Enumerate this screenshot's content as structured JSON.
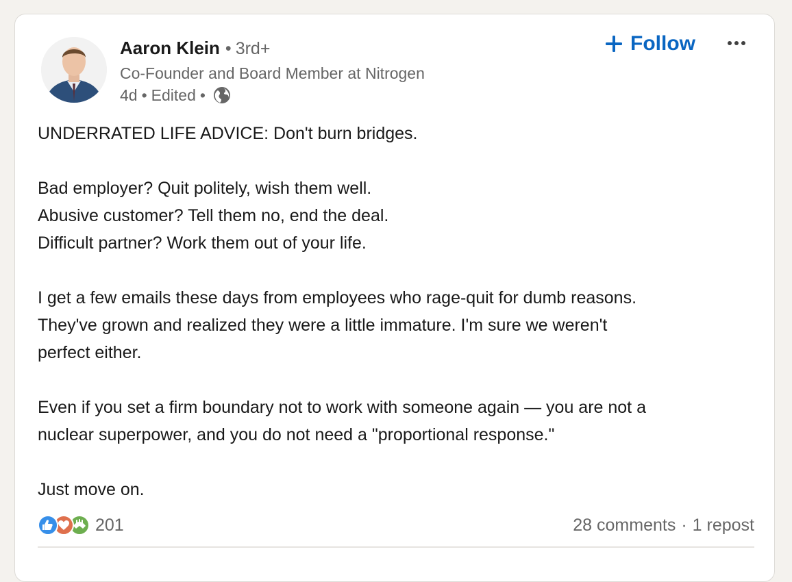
{
  "actor": {
    "name": "Aaron Klein",
    "degree": "3rd+",
    "headline": "Co-Founder and Board Member at Nitrogen",
    "time": "4d",
    "edited": "Edited",
    "visibility_icon": "globe-icon"
  },
  "actions": {
    "follow_label": "Follow",
    "follow_icon": "plus-icon",
    "more_icon": "ellipsis-icon"
  },
  "post": {
    "paragraphs": [
      [
        "UNDERRATED LIFE ADVICE: Don't burn bridges."
      ],
      [
        "Bad employer? Quit politely, wish them well.",
        "Abusive customer? Tell them no, end the deal.",
        "Difficult partner? Work them out of your life."
      ],
      [
        "I get a few emails these days from employees who rage-quit for dumb reasons.",
        "They've grown and realized they were a little immature. I'm sure we weren't",
        "perfect either."
      ],
      [
        "Even if you set a firm boundary not to work with someone again — you are not a",
        "nuclear superpower, and you do not need a \"proportional response.\""
      ],
      [
        "Just move on."
      ]
    ]
  },
  "social": {
    "reaction_icons": [
      "like-icon",
      "love-icon",
      "support-icon"
    ],
    "reaction_count": "201",
    "comments": "28 comments",
    "reposts": "1 repost"
  },
  "colors": {
    "accent": "#0a66c2",
    "like": "#378fe9",
    "love": "#df704d",
    "support": "#6dae4f",
    "text": "#191919",
    "muted": "#666666"
  }
}
